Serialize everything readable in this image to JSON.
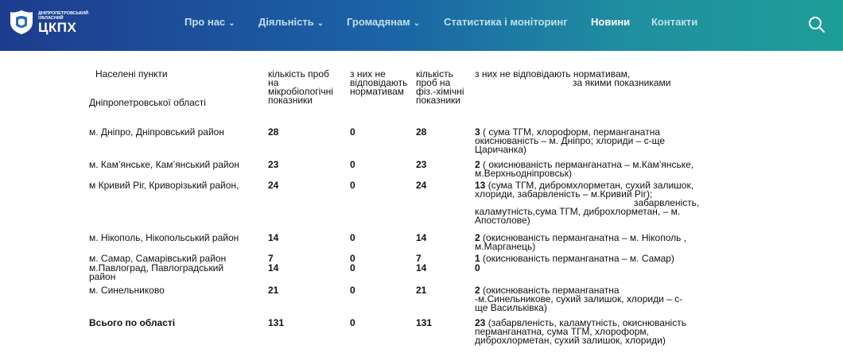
{
  "brand": {
    "small": "Дніпропетровський обласний",
    "big": "ЦКПХ",
    "colors": {
      "header_start": "#1e3c8f",
      "header_end": "#1e9e98"
    }
  },
  "nav": [
    {
      "label": "Про нас",
      "dropdown": true
    },
    {
      "label": "Діяльність",
      "dropdown": true
    },
    {
      "label": "Громадянам",
      "dropdown": true
    },
    {
      "label": "Статистика і моніторинг",
      "dropdown": false
    },
    {
      "label": "Новини",
      "dropdown": false,
      "active": true
    },
    {
      "label": "Контакти",
      "dropdown": false
    }
  ],
  "search_icon": "search-icon",
  "table": {
    "headers": {
      "col1_line1": "Населені пункти",
      "col1_line2": "Дніпропетровської області",
      "col2": [
        "кількість проб",
        "на",
        "мікробіологічні",
        "показники"
      ],
      "col3": [
        "з них не",
        "відповідають",
        "нормативам"
      ],
      "col4": [
        "кількість",
        "проб на",
        "фіз.-хімічні",
        "показники"
      ],
      "col5": [
        "з них не відповідають нормативам,",
        "за якими показниками"
      ]
    },
    "rows": [
      {
        "place": "м. Дніпро, Дніпровський район",
        "micro": "28",
        "micro_bad": "0",
        "chem": "28",
        "detail_num": "3",
        "detail": [
          " ( сума ТГМ,  хлороформ, перманганатна",
          "окиснюваність – м. Дніпро;  хлориди  – с-ще",
          "Царичанка)"
        ]
      },
      {
        "place": "м. Кам’янське,  Кам’янський район",
        "micro": "23",
        "micro_bad": "0",
        "chem": "23",
        "detail_num": "2",
        "detail": [
          " ( окиснюваність перманганатна  –  м.Кам’янське,",
          "м.Верхньодніпровськ)"
        ]
      },
      {
        "place": "м Кривий Ріг, Криворізький район,",
        "micro": "24",
        "micro_bad": "0",
        "chem": "24",
        "detail_num": "13",
        "detail": [
          " (сума ТГМ, дибромхлорметан, сухий залишок,",
          "хлориди, забарвленість  – м.Кривий Ріг);",
          "забарвленість,",
          "каламутність,сума ТГМ,  диброхлорметан,  – м.",
          "Апостолове)"
        ]
      },
      {
        "place": "м. Нікополь, Нікопольський район",
        "micro": "14",
        "micro_bad": "0",
        "chem": "14",
        "detail_num": "2",
        "detail": [
          " (окиснюваність перманганатна – м. Нікополь ,",
          " м.Марганець)"
        ]
      },
      {
        "place": "м. Самар, Самарівський район",
        "micro": "7",
        "micro_bad": "0",
        "chem": "7",
        "detail_num": "1",
        "detail": [
          " (окиснюваність перманганатна – м. Самар)"
        ]
      },
      {
        "place": "м.Павлоград, Павлоградський",
        "place2": "район",
        "micro": "14",
        "micro_bad": "0",
        "chem": "14",
        "detail_num": "0",
        "detail": []
      },
      {
        "place": "м. Синельниково",
        "micro": "21",
        "micro_bad": "0",
        "chem": "21",
        "detail_num": "2",
        "detail": [
          "  (окиснюваність перманганатна",
          " -м.Синельникове,       сухий залишок, хлориди –  с-",
          "ще Васильківка)"
        ]
      },
      {
        "place": "Всього по області",
        "micro": "131",
        "micro_bad": "0",
        "chem": "131",
        "detail_num": "23",
        "detail": [
          "  (забарвленість, каламутність, окиснюваність",
          "перманганатна, сума ТГМ, хлороформ,",
          "диброхлорметан, сухий залишок, хлориди)"
        ]
      }
    ]
  }
}
